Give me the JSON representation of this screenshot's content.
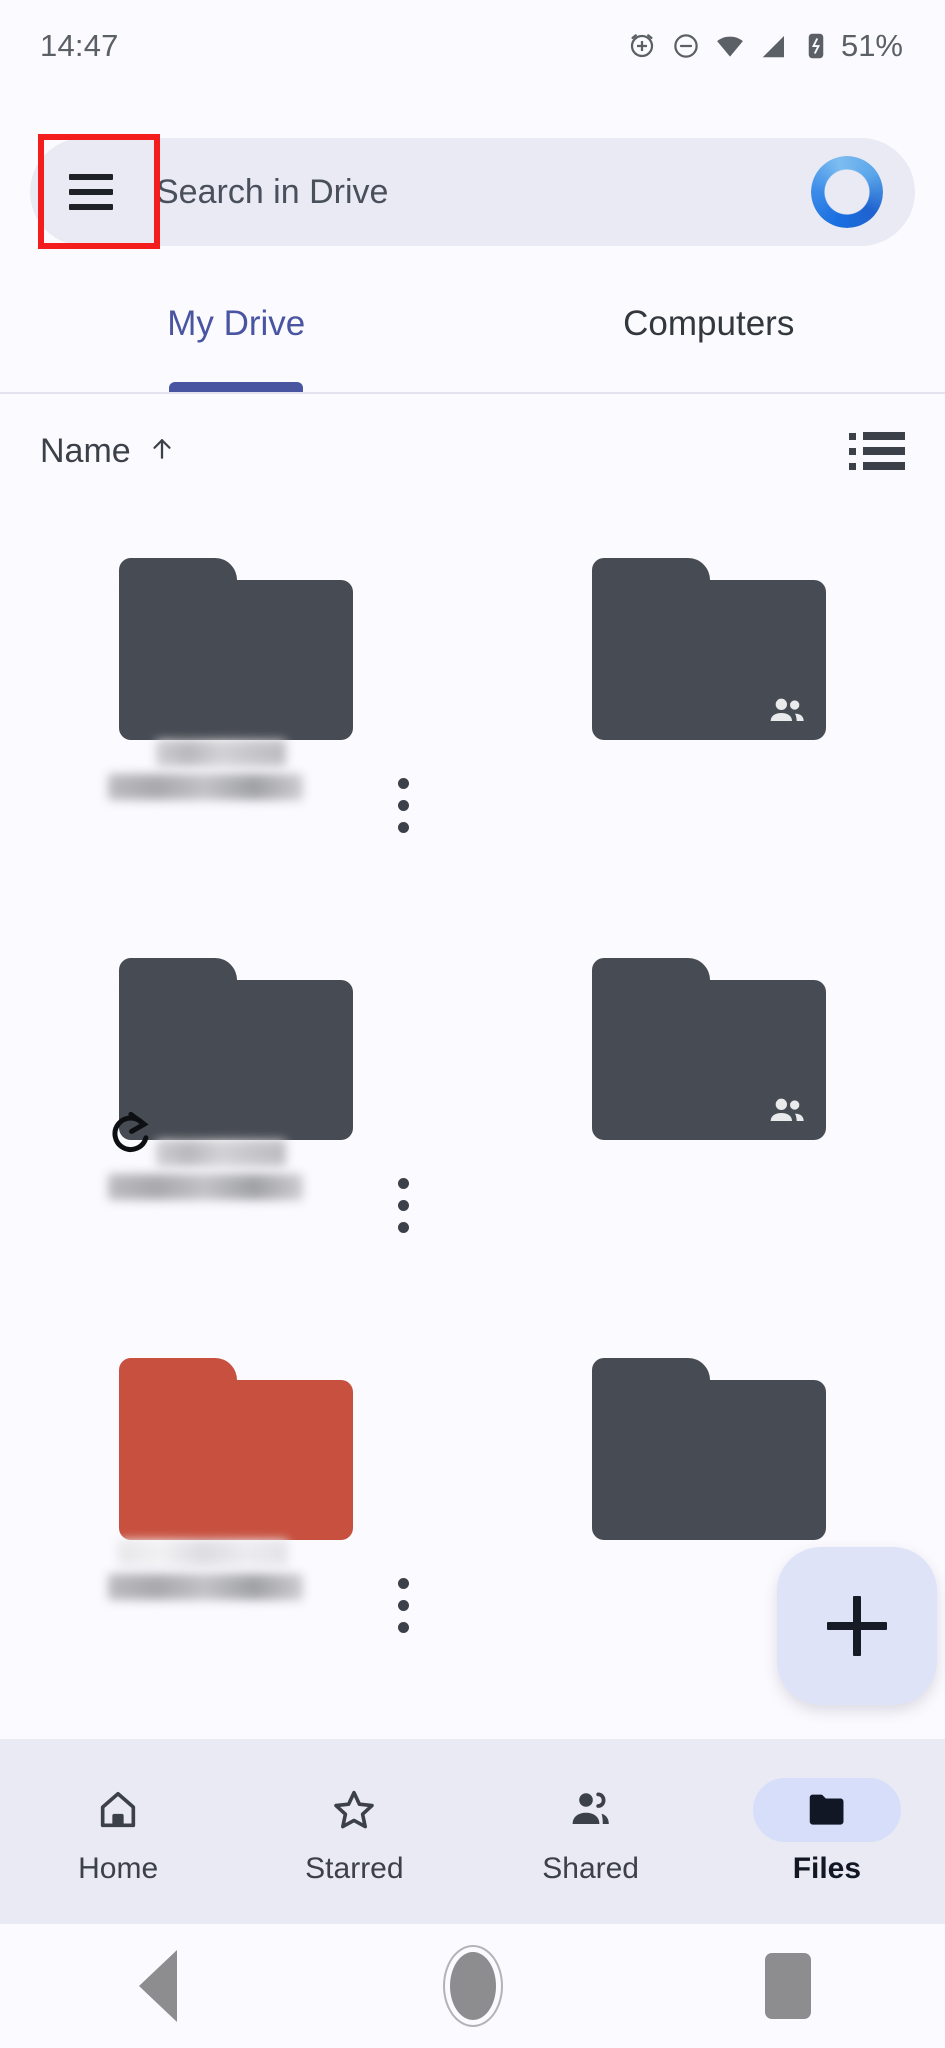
{
  "status_bar": {
    "time": "14:47",
    "battery": "51%",
    "icons": [
      "alarm-add-icon",
      "do-not-disturb-icon",
      "wifi-icon",
      "cellular-signal-icon",
      "battery-charging-icon"
    ]
  },
  "search": {
    "menu_icon": "hamburger-menu-icon",
    "placeholder": "Search in Drive",
    "avatar": "account-avatar-ring",
    "highlight_color": "#f41d1d"
  },
  "tabs": [
    {
      "label": "My Drive",
      "active": true
    },
    {
      "label": "Computers",
      "active": false
    }
  ],
  "sort": {
    "label": "Name",
    "direction_icon": "arrow-up-icon",
    "view_toggle_icon": "list-view-icon"
  },
  "grid": {
    "items": [
      {
        "id": 1,
        "type": "folder",
        "color": "#474b53",
        "name": "",
        "shared": false,
        "synced": false,
        "side": "left"
      },
      {
        "id": 2,
        "type": "folder",
        "color": "#474b53",
        "name": "",
        "shared": true,
        "synced": false,
        "side": "right"
      },
      {
        "id": 3,
        "type": "folder",
        "color": "#474b53",
        "name": "",
        "shared": false,
        "synced": true,
        "side": "left"
      },
      {
        "id": 4,
        "type": "folder",
        "color": "#474b53",
        "name": "",
        "shared": true,
        "synced": false,
        "side": "right"
      },
      {
        "id": 5,
        "type": "folder",
        "color": "#c8503e",
        "name": "",
        "shared": false,
        "synced": false,
        "side": "left"
      },
      {
        "id": 6,
        "type": "folder",
        "color": "#474b53",
        "name": "",
        "shared": false,
        "synced": false,
        "side": "right"
      }
    ],
    "overflow_icon": "more-vert-icon"
  },
  "fab": {
    "icon": "plus-icon",
    "background": "#dfe3f7"
  },
  "bottom_nav": [
    {
      "label": "Home",
      "icon": "home-icon",
      "active": false
    },
    {
      "label": "Starred",
      "icon": "star-outline-icon",
      "active": false
    },
    {
      "label": "Shared",
      "icon": "people-icon",
      "active": false
    },
    {
      "label": "Files",
      "icon": "folder-icon",
      "active": true
    }
  ],
  "android_nav": [
    {
      "name": "back-button",
      "icon": "triangle-back-icon"
    },
    {
      "name": "home-button",
      "icon": "circle-home-icon"
    },
    {
      "name": "recents-button",
      "icon": "square-recents-icon"
    }
  ]
}
